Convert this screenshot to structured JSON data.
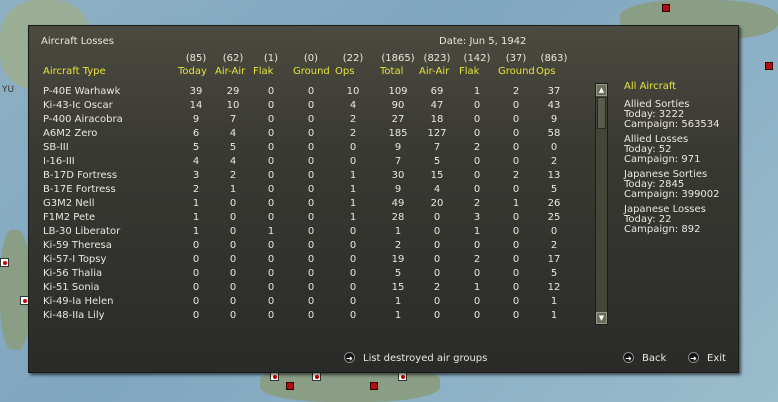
{
  "title": "Aircraft Losses",
  "date": "Date: Jun 5, 1942",
  "columns": [
    {
      "total": "(85)",
      "label": "Today"
    },
    {
      "total": "(62)",
      "label": "Air-Air"
    },
    {
      "total": "(1)",
      "label": "Flak"
    },
    {
      "total": "(0)",
      "label": "Ground"
    },
    {
      "total": "(22)",
      "label": "Ops"
    },
    {
      "total": "(1865)",
      "label": "Total"
    },
    {
      "total": "(823)",
      "label": "Air-Air"
    },
    {
      "total": "(142)",
      "label": "Flak"
    },
    {
      "total": "(37)",
      "label": "Ground"
    },
    {
      "total": "(863)",
      "label": "Ops"
    }
  ],
  "type_header": "Aircraft Type",
  "rows": [
    [
      "P-40E Warhawk",
      "39",
      "29",
      "0",
      "0",
      "10",
      "109",
      "69",
      "1",
      "2",
      "37"
    ],
    [
      "Ki-43-Ic Oscar",
      "14",
      "10",
      "0",
      "0",
      "4",
      "90",
      "47",
      "0",
      "0",
      "43"
    ],
    [
      "P-400 Airacobra",
      "9",
      "7",
      "0",
      "0",
      "2",
      "27",
      "18",
      "0",
      "0",
      "9"
    ],
    [
      "A6M2 Zero",
      "6",
      "4",
      "0",
      "0",
      "2",
      "185",
      "127",
      "0",
      "0",
      "58"
    ],
    [
      "SB-III",
      "5",
      "5",
      "0",
      "0",
      "0",
      "9",
      "7",
      "2",
      "0",
      "0"
    ],
    [
      "I-16-III",
      "4",
      "4",
      "0",
      "0",
      "0",
      "7",
      "5",
      "0",
      "0",
      "2"
    ],
    [
      "B-17D Fortress",
      "3",
      "2",
      "0",
      "0",
      "1",
      "30",
      "15",
      "0",
      "2",
      "13"
    ],
    [
      "B-17E Fortress",
      "2",
      "1",
      "0",
      "0",
      "1",
      "9",
      "4",
      "0",
      "0",
      "5"
    ],
    [
      "G3M2 Nell",
      "1",
      "0",
      "0",
      "0",
      "1",
      "49",
      "20",
      "2",
      "1",
      "26"
    ],
    [
      "F1M2 Pete",
      "1",
      "0",
      "0",
      "0",
      "1",
      "28",
      "0",
      "3",
      "0",
      "25"
    ],
    [
      "LB-30 Liberator",
      "1",
      "0",
      "1",
      "0",
      "0",
      "1",
      "0",
      "1",
      "0",
      "0"
    ],
    [
      "Ki-59 Theresa",
      "0",
      "0",
      "0",
      "0",
      "0",
      "2",
      "0",
      "0",
      "0",
      "2"
    ],
    [
      "Ki-57-I Topsy",
      "0",
      "0",
      "0",
      "0",
      "0",
      "19",
      "0",
      "2",
      "0",
      "17"
    ],
    [
      "Ki-56 Thalia",
      "0",
      "0",
      "0",
      "0",
      "0",
      "5",
      "0",
      "0",
      "0",
      "5"
    ],
    [
      "Ki-51 Sonia",
      "0",
      "0",
      "0",
      "0",
      "0",
      "15",
      "2",
      "1",
      "0",
      "12"
    ],
    [
      "Ki-49-Ia Helen",
      "0",
      "0",
      "0",
      "0",
      "0",
      "1",
      "0",
      "0",
      "0",
      "1"
    ],
    [
      "Ki-48-IIa Lily",
      "0",
      "0",
      "0",
      "0",
      "0",
      "1",
      "0",
      "0",
      "0",
      "1"
    ]
  ],
  "side": {
    "filter": "All Aircraft",
    "blocks": [
      {
        "title": "Allied Sorties",
        "today": "Today:   3222",
        "campaign": "Campaign: 563534"
      },
      {
        "title": "Allied Losses",
        "today": "Today:   52",
        "campaign": "Campaign: 971"
      },
      {
        "title": "Japanese Sorties",
        "today": "Today:   2845",
        "campaign": "Campaign: 399002"
      },
      {
        "title": "Japanese Losses",
        "today": "Today:   22",
        "campaign": "Campaign: 892"
      }
    ]
  },
  "buttons": {
    "list": "List destroyed air groups",
    "back": "Back",
    "exit": "Exit"
  },
  "map_labels": {
    "yu": "YU"
  },
  "colors": {
    "header": "#e4e43a",
    "text": "#e8e8e0"
  }
}
